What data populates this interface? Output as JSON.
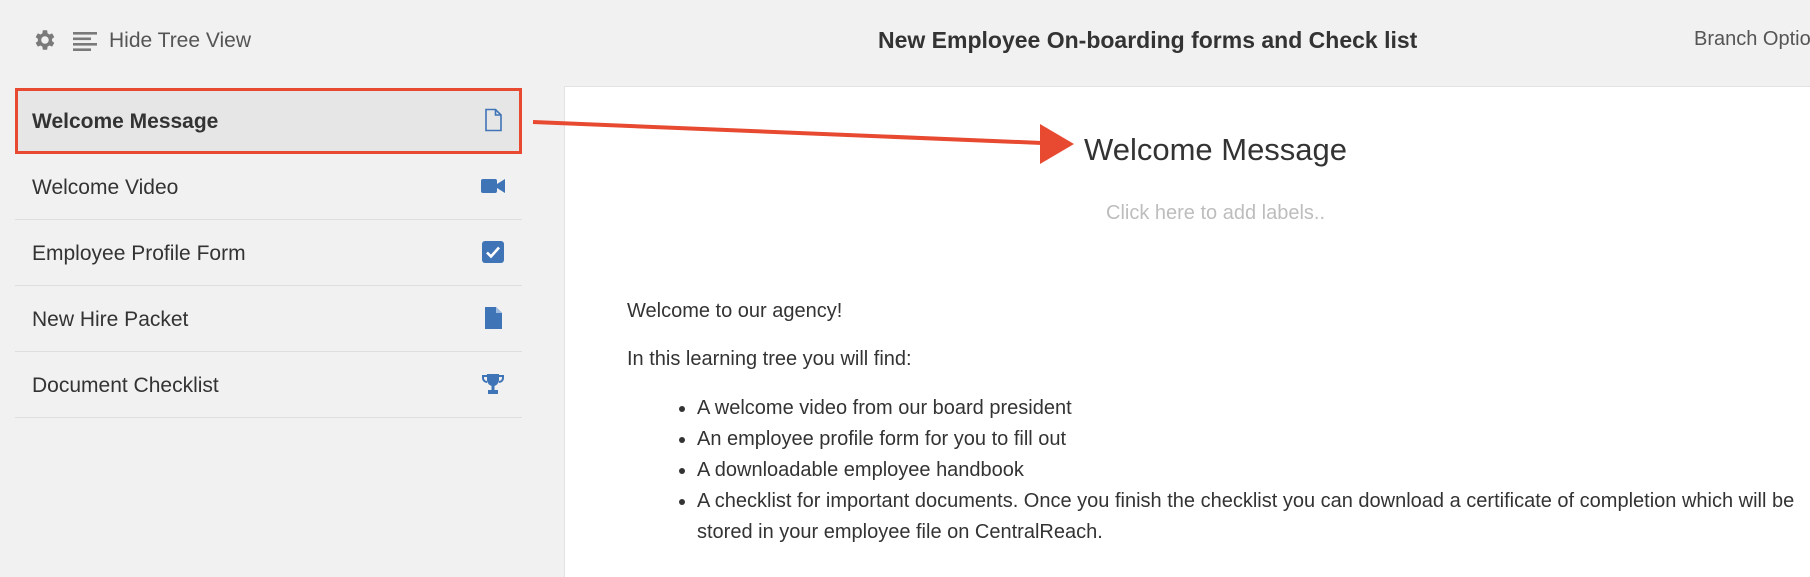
{
  "header": {
    "hide_tree_label": "Hide Tree View",
    "title": "New Employee On-boarding forms and Check list",
    "branch_options": "Branch Optio"
  },
  "sidebar": {
    "items": [
      {
        "label": "Welcome Message",
        "icon": "document-outline-icon",
        "active": true
      },
      {
        "label": "Welcome Video",
        "icon": "video-camera-icon"
      },
      {
        "label": "Employee Profile Form",
        "icon": "checkbox-icon"
      },
      {
        "label": "New Hire Packet",
        "icon": "document-filled-icon"
      },
      {
        "label": "Document Checklist",
        "icon": "trophy-icon"
      }
    ]
  },
  "content": {
    "title": "Welcome Message",
    "labels_placeholder": "Click here to add labels..",
    "intro": "Welcome to our agency!",
    "lead": "In this learning tree you will find:",
    "bullets": [
      "A welcome video from our board president",
      "An employee profile form for you to fill out",
      "A downloadable employee handbook",
      "A checklist for important documents. Once you finish the checklist you can download a certificate of completion which will be stored in your employee file on CentralReach."
    ]
  },
  "colors": {
    "highlight": "#e74a30",
    "icon_blue": "#3f74b7"
  }
}
